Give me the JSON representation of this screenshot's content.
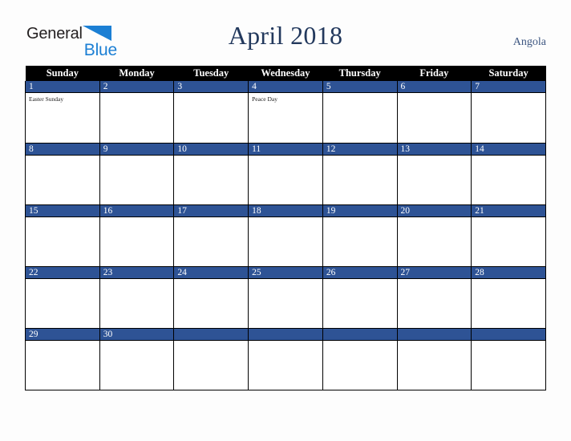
{
  "brand": {
    "name_part1": "General",
    "name_part2": "Blue",
    "triangle_color": "#1b7fd4",
    "text_color": "#231f20"
  },
  "header": {
    "title": "April 2018",
    "country": "Angola",
    "title_color": "#23395d",
    "country_color": "#3c5580"
  },
  "calendar": {
    "weekdays": [
      "Sunday",
      "Monday",
      "Tuesday",
      "Wednesday",
      "Thursday",
      "Friday",
      "Saturday"
    ],
    "header_bg": "#000000",
    "header_fg": "#ffffff",
    "daynum_bg": "#2e5395",
    "daynum_fg": "#ffffff",
    "cell_bg": "#ffffff",
    "grid_color": "#000000",
    "weeks": [
      [
        {
          "day": "1",
          "events": [
            "Easter Sunday"
          ]
        },
        {
          "day": "2",
          "events": []
        },
        {
          "day": "3",
          "events": []
        },
        {
          "day": "4",
          "events": [
            "Peace Day"
          ]
        },
        {
          "day": "5",
          "events": []
        },
        {
          "day": "6",
          "events": []
        },
        {
          "day": "7",
          "events": []
        }
      ],
      [
        {
          "day": "8",
          "events": []
        },
        {
          "day": "9",
          "events": []
        },
        {
          "day": "10",
          "events": []
        },
        {
          "day": "11",
          "events": []
        },
        {
          "day": "12",
          "events": []
        },
        {
          "day": "13",
          "events": []
        },
        {
          "day": "14",
          "events": []
        }
      ],
      [
        {
          "day": "15",
          "events": []
        },
        {
          "day": "16",
          "events": []
        },
        {
          "day": "17",
          "events": []
        },
        {
          "day": "18",
          "events": []
        },
        {
          "day": "19",
          "events": []
        },
        {
          "day": "20",
          "events": []
        },
        {
          "day": "21",
          "events": []
        }
      ],
      [
        {
          "day": "22",
          "events": []
        },
        {
          "day": "23",
          "events": []
        },
        {
          "day": "24",
          "events": []
        },
        {
          "day": "25",
          "events": []
        },
        {
          "day": "26",
          "events": []
        },
        {
          "day": "27",
          "events": []
        },
        {
          "day": "28",
          "events": []
        }
      ],
      [
        {
          "day": "29",
          "events": []
        },
        {
          "day": "30",
          "events": []
        },
        {
          "day": "",
          "events": []
        },
        {
          "day": "",
          "events": []
        },
        {
          "day": "",
          "events": []
        },
        {
          "day": "",
          "events": []
        },
        {
          "day": "",
          "events": []
        }
      ]
    ]
  }
}
